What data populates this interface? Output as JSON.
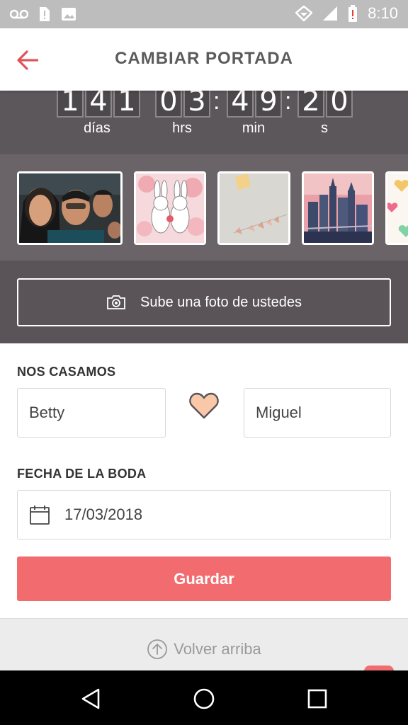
{
  "status_bar": {
    "time": "8:10",
    "icons": [
      "voicemail-icon",
      "sim-alert-icon",
      "image-icon",
      "data-saver-icon",
      "signal-icon",
      "battery-alert-icon"
    ]
  },
  "app_bar": {
    "title": "CAMBIAR PORTADA",
    "back_icon": "arrow-left-icon",
    "accent": "#e0535a"
  },
  "countdown": {
    "days": "141",
    "hours": "03",
    "minutes": "49",
    "seconds": "20",
    "labels": {
      "days": "días",
      "hours": "hrs",
      "minutes": "min",
      "seconds": "s"
    }
  },
  "photos": {
    "items": [
      "couple-selfie",
      "bunnies-illustration",
      "bunting-flags",
      "city-skyline",
      "hearts-pattern"
    ]
  },
  "upload": {
    "label": "Sube una foto de ustedes",
    "icon": "camera-icon"
  },
  "form": {
    "married_label": "NOS CASAMOS",
    "partner1": "Betty",
    "partner2": "Miguel",
    "heart_icon": "heart-icon",
    "date_label": "FECHA DE LA BODA",
    "date_value": "17/03/2018",
    "calendar_icon": "calendar-icon",
    "save_label": "Guardar",
    "save_color": "#f26b6f"
  },
  "footer": {
    "back_to_top": "Volver arriba",
    "icon": "arrow-up-circle-icon"
  },
  "nav_bar": {
    "icons": [
      "back-triangle-icon",
      "home-circle-icon",
      "recents-square-icon"
    ]
  }
}
